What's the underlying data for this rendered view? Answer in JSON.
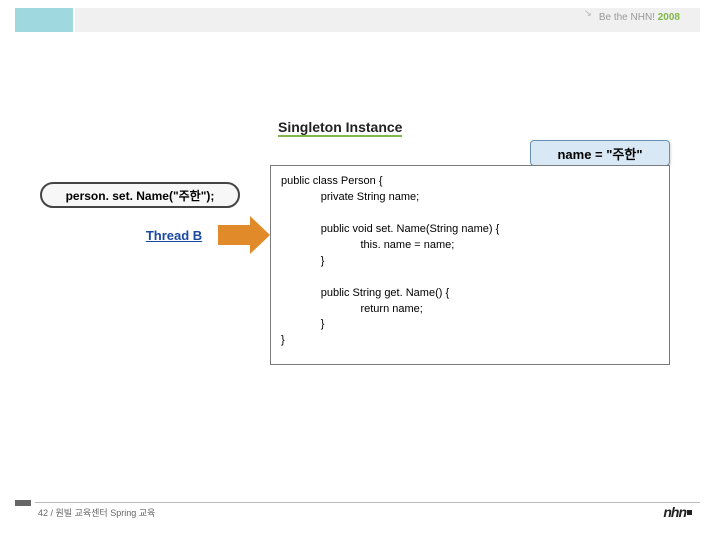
{
  "header": {
    "text": "Be the NHN!",
    "year": "2008"
  },
  "title": "Singleton Instance",
  "nameBox": "name = \"주한\"",
  "callout": "person. set. Name(\"주한\");",
  "threadLabel": "Thread B",
  "code": "public class Person {\n             private String name;\n\n             public void set. Name(String name) {\n                          this. name = name;\n             }\n\n             public String get. Name() {\n                          return name;\n             }\n}",
  "footer": {
    "pageText": "42 / 원빌 교육센터 Spring 교육",
    "logo": "nhn"
  }
}
